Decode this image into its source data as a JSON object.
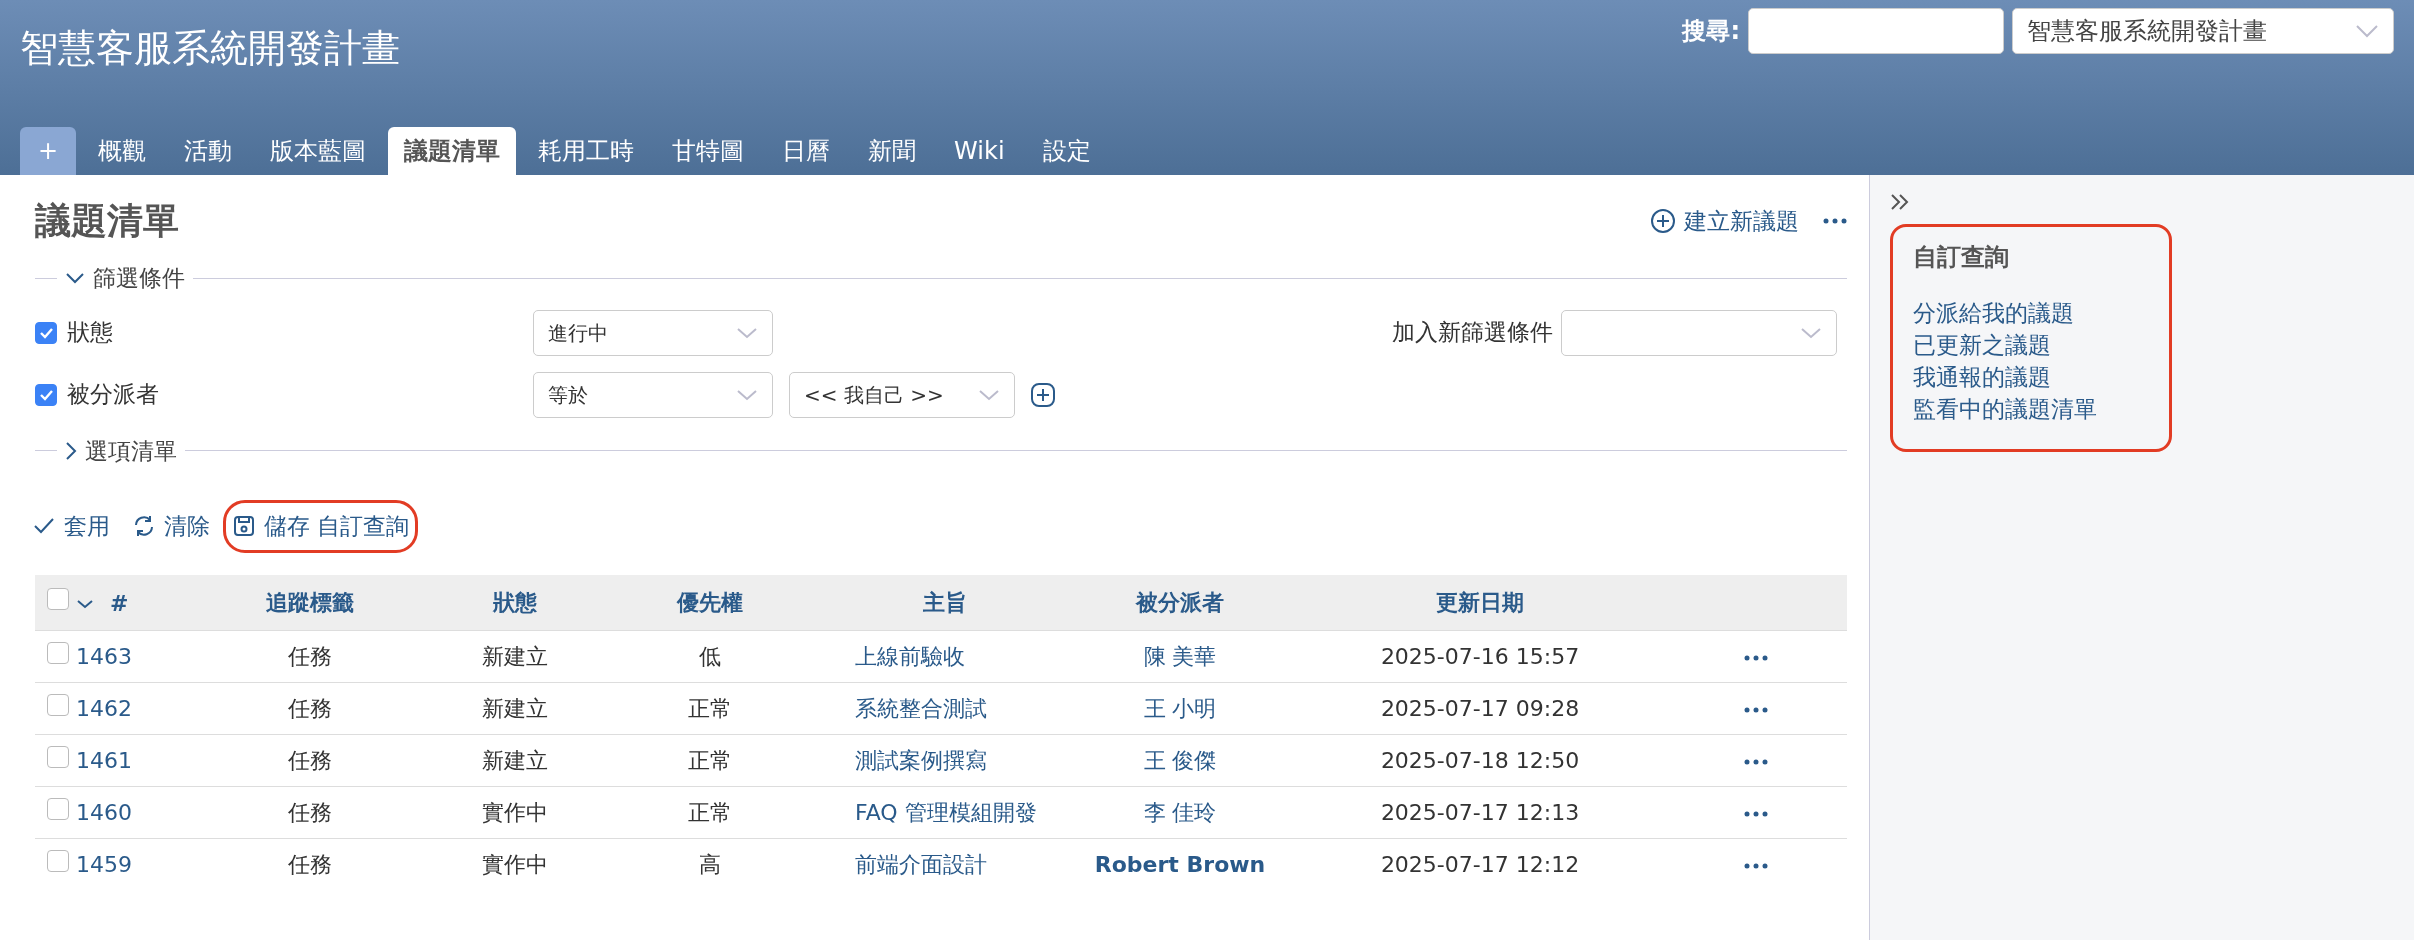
{
  "header": {
    "title": "智慧客服系統開發計畫",
    "search_label": "搜尋:",
    "project_select": "智慧客服系統開發計畫"
  },
  "tabs": [
    {
      "label": "+",
      "kind": "new",
      "selected": false
    },
    {
      "label": "概觀",
      "kind": "tab",
      "selected": false
    },
    {
      "label": "活動",
      "kind": "tab",
      "selected": false
    },
    {
      "label": "版本藍圖",
      "kind": "tab",
      "selected": false
    },
    {
      "label": "議題清單",
      "kind": "tab",
      "selected": true
    },
    {
      "label": "耗用工時",
      "kind": "tab",
      "selected": false
    },
    {
      "label": "甘特圖",
      "kind": "tab",
      "selected": false
    },
    {
      "label": "日曆",
      "kind": "tab",
      "selected": false
    },
    {
      "label": "新聞",
      "kind": "tab",
      "selected": false
    },
    {
      "label": "Wiki",
      "kind": "tab",
      "selected": false
    },
    {
      "label": "設定",
      "kind": "tab",
      "selected": false
    }
  ],
  "page": {
    "title": "議題清單",
    "new_issue": "建立新議題"
  },
  "filters": {
    "legend": "篩選條件",
    "expanded": true,
    "add_label": "加入新篩選條件",
    "rows": [
      {
        "label": "狀態",
        "checked": true,
        "operator": "進行中",
        "value": null
      },
      {
        "label": "被分派者",
        "checked": true,
        "operator": "等於",
        "value": "<< 我自己 >>"
      }
    ]
  },
  "options": {
    "legend": "選項清單",
    "expanded": false
  },
  "actions": [
    {
      "label": "套用",
      "kind": "apply",
      "highlighted": false
    },
    {
      "label": "清除",
      "kind": "clear",
      "highlighted": false
    },
    {
      "label": "儲存 自訂查詢",
      "kind": "save",
      "highlighted": true
    }
  ],
  "table": {
    "select_all_checked": false,
    "columns": [
      "#",
      "追蹤標籤",
      "狀態",
      "優先權",
      "主旨",
      "被分派者",
      "更新日期"
    ],
    "rows": [
      {
        "id": "1463",
        "tracker": "任務",
        "status": "新建立",
        "priority": "低",
        "subject": "上線前驗收",
        "assignee": "陳 美華",
        "assignee_bold": false,
        "updated": "2025-07-16 15:57",
        "checked": false
      },
      {
        "id": "1462",
        "tracker": "任務",
        "status": "新建立",
        "priority": "正常",
        "subject": "系統整合測試",
        "assignee": "王 小明",
        "assignee_bold": false,
        "updated": "2025-07-17 09:28",
        "checked": false
      },
      {
        "id": "1461",
        "tracker": "任務",
        "status": "新建立",
        "priority": "正常",
        "subject": "測試案例撰寫",
        "assignee": "王 俊傑",
        "assignee_bold": false,
        "updated": "2025-07-18 12:50",
        "checked": false
      },
      {
        "id": "1460",
        "tracker": "任務",
        "status": "實作中",
        "priority": "正常",
        "subject": "FAQ 管理模組開發",
        "assignee": "李 佳玲",
        "assignee_bold": false,
        "updated": "2025-07-17 12:13",
        "checked": false
      },
      {
        "id": "1459",
        "tracker": "任務",
        "status": "實作中",
        "priority": "高",
        "subject": "前端介面設計",
        "assignee": "Robert Brown",
        "assignee_bold": true,
        "updated": "2025-07-17 12:12",
        "checked": false
      }
    ]
  },
  "sidebar": {
    "title": "自訂查詢",
    "highlighted": true,
    "links": [
      "分派給我的議題",
      "已更新之議題",
      "我通報的議題",
      "監看中的議題清單"
    ]
  }
}
